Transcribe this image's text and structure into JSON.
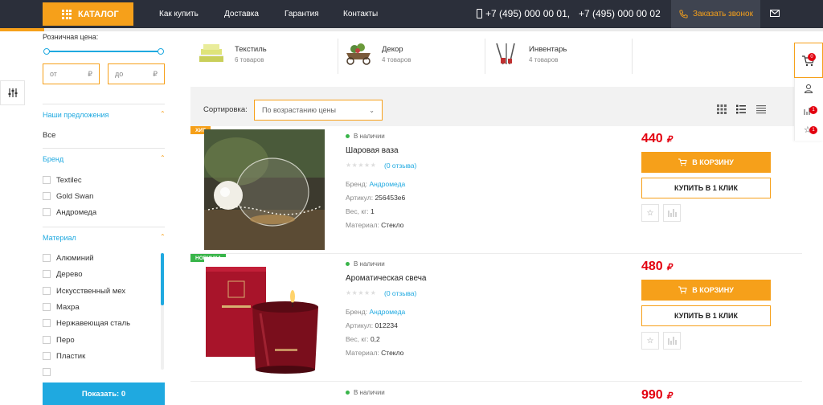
{
  "header": {
    "catalog_label": "КАТАЛОГ",
    "nav": [
      "Как купить",
      "Доставка",
      "Гарантия",
      "Контакты"
    ],
    "phone1": "+7 (495) 000 00 01,",
    "phone2": "+7 (495) 000 00 02",
    "callback_label": "Заказать звонок"
  },
  "filter": {
    "price_title": "Розничная цена:",
    "price_from_placeholder": "от",
    "price_to_placeholder": "до",
    "currency": "₽",
    "offers_title": "Наши предложения",
    "offers_value": "Все",
    "brand_title": "Бренд",
    "brands": [
      "Textilec",
      "Gold Swan",
      "Андромеда"
    ],
    "material_title": "Материал",
    "materials": [
      "Алюминий",
      "Дерево",
      "Искусственный мех",
      "Махра",
      "Нержавеющая сталь",
      "Перо",
      "Пластик"
    ],
    "show_label": "Показать: 0"
  },
  "categories": [
    {
      "name": "Текстиль",
      "count": "6 товаров"
    },
    {
      "name": "Декор",
      "count": "4 товаров"
    },
    {
      "name": "Инвентарь",
      "count": "4 товаров"
    }
  ],
  "sort": {
    "label": "Сортировка:",
    "value": "По возрастанию цены"
  },
  "products": [
    {
      "badge": "ХИТ",
      "badge_color": "#f6a01a",
      "stock": "В наличии",
      "name": "Шаровая ваза",
      "reviews": "(0 отзыва)",
      "brand_label": "Бренд:",
      "brand": "Андромеда",
      "sku_label": "Артикул:",
      "sku": "256453е6",
      "weight_label": "Вес, кг:",
      "weight": "1",
      "material_label": "Материал:",
      "material": "Стекло",
      "price": "440",
      "currency": "₽",
      "cart_label": "В КОРЗИНУ",
      "oneclick_label": "КУПИТЬ В 1 КЛИК"
    },
    {
      "badge": "НОВИНКА",
      "badge_color": "#39b54a",
      "stock": "В наличии",
      "name": "Ароматическая свеча",
      "reviews": "(0 отзыва)",
      "brand_label": "Бренд:",
      "brand": "Андромеда",
      "sku_label": "Артикул:",
      "sku": "012234",
      "weight_label": "Вес, кг:",
      "weight": "0,2",
      "material_label": "Материал:",
      "material": "Стекло",
      "price": "480",
      "currency": "₽",
      "cart_label": "В КОРЗИНУ",
      "oneclick_label": "КУПИТЬ В 1 КЛИК"
    },
    {
      "stock": "В наличии",
      "price": "990",
      "currency": "₽"
    }
  ],
  "side_panel": {
    "cart_count": "0",
    "compare_count": "1",
    "favorites_count": "1"
  },
  "colors": {
    "accent": "#f6a01a",
    "link": "#1fa9e0",
    "price": "#e3000f",
    "header_bg": "#2b2f3a"
  }
}
